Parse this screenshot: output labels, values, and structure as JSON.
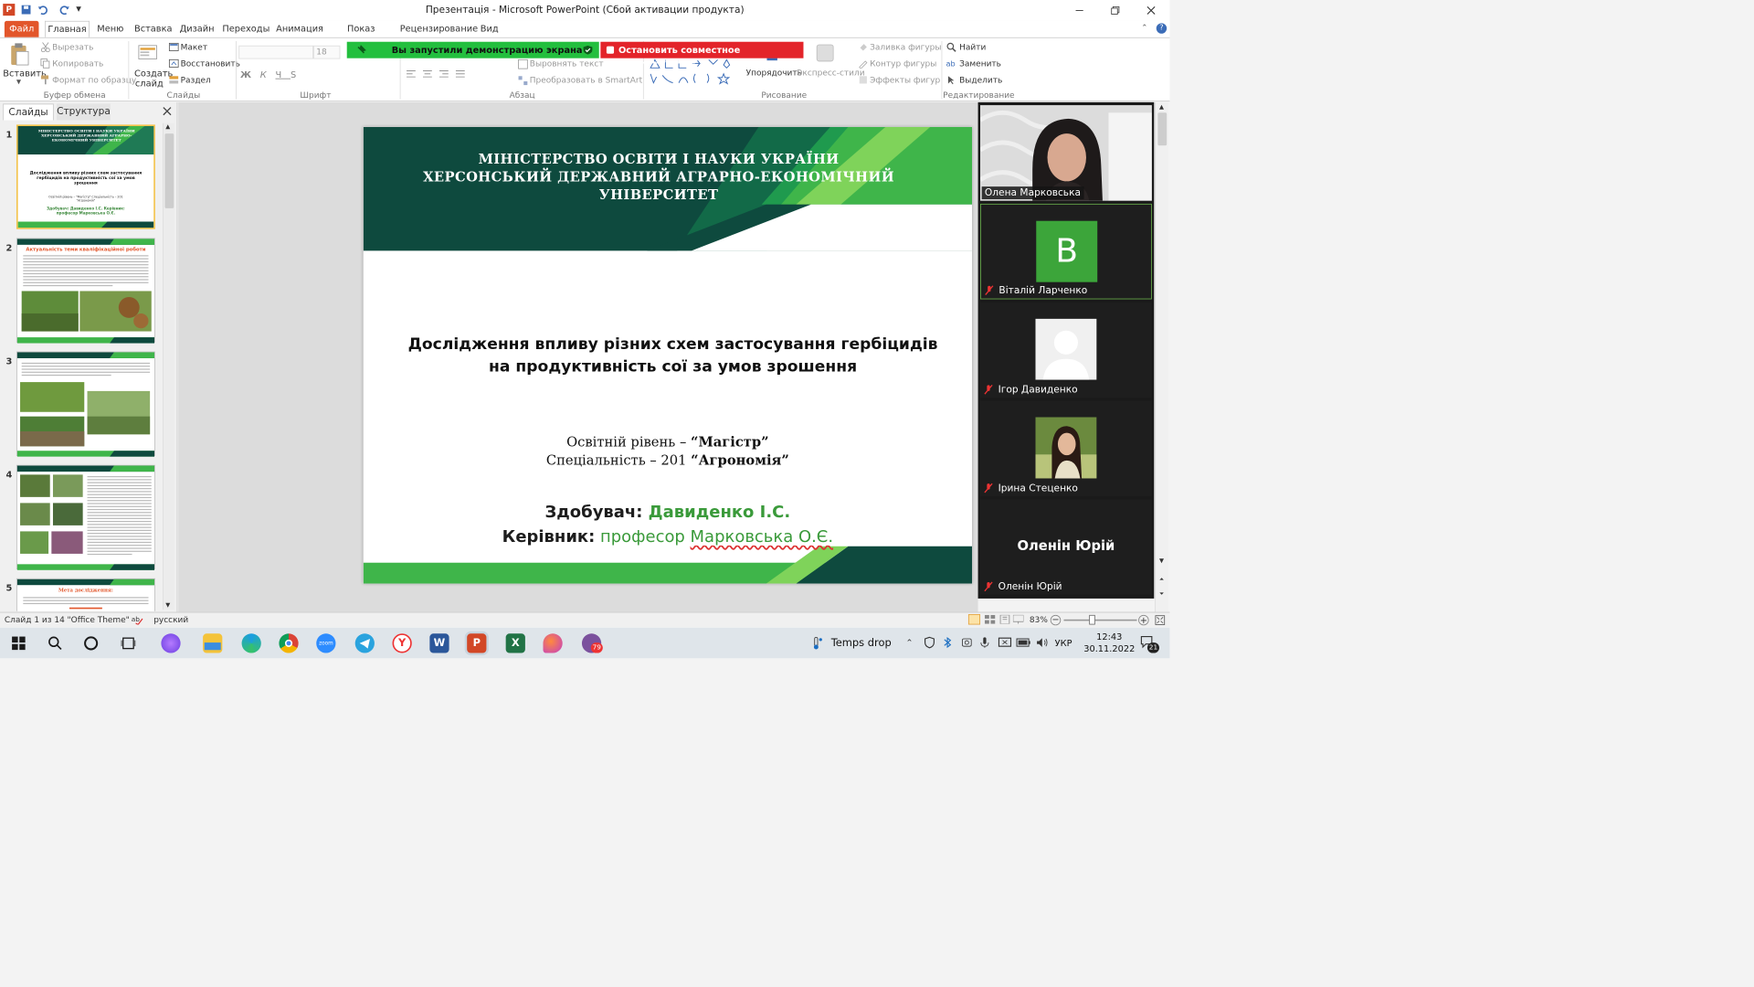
{
  "window": {
    "title": "Презентація  -  Microsoft PowerPoint (Сбой активации продукта)"
  },
  "tabs": [
    "Файл",
    "Главная",
    "Меню",
    "Вставка",
    "Дизайн",
    "Переходы",
    "Анимация",
    "Показ слайдов",
    "Рецензирование",
    "Вид"
  ],
  "ribbon": {
    "paste": "Вставить",
    "cut": "Вырезать",
    "copy": "Копировать",
    "format_painter": "Формат по образцу",
    "clipboard_group": "Буфер обмена",
    "new_slide": "Создать слайд",
    "layout": "Макет",
    "reset": "Восстановить",
    "section": "Раздел",
    "slides_group": "Слайды",
    "font_size": "18",
    "font_group": "Шрифт",
    "align_text": "Выровнять текст",
    "smartart": "Преобразовать в SmartArt",
    "paragraph_group": "Абзац",
    "arrange": "Упорядочить",
    "quick_styles": "Экспресс-стили",
    "shape_fill": "Заливка фигуры",
    "shape_outline": "Контур фигуры",
    "shape_effects": "Эффекты фигур",
    "drawing_group": "Рисование",
    "find": "Найти",
    "replace": "Заменить",
    "select": "Выделить",
    "editing_group": "Редактирование"
  },
  "share_notice": {
    "text": "Вы запустили демонстрацию экрана",
    "stop": "Остановить совместное использование"
  },
  "panel": {
    "tab_slides": "Слайды",
    "tab_outline": "Структура"
  },
  "thumbs": [
    {
      "num": "1",
      "header": "МІНІСТЕРСТВО ОСВІТИ І НАУКИ УКРАЇНИ ХЕРСОНСЬКИЙ ДЕРЖАВНИЙ АГРАРНО-ЕКОНОМІЧНИЙ УНІВЕРСИТЕТ",
      "title": "Дослідження впливу різних схем застосування гербіцидів на продуктивність сої за умов зрошення",
      "sub": "Освітній рівень – \"Магістр\" Спеціальність – 201 \"Агрономія\"",
      "authors": "Здобувач: Давиденко І.С. Керівник: професор Марковська О.Є."
    },
    {
      "num": "2",
      "title": "Актуальність теми кваліфікаційної роботи"
    },
    {
      "num": "3"
    },
    {
      "num": "4"
    },
    {
      "num": "5",
      "title": "Мета дослідження:"
    }
  ],
  "slide": {
    "header_line1": "МІНІСТЕРСТВО  ОСВІТИ  І  НАУКИ  УКРАЇНИ",
    "header_line2": "ХЕРСОНСЬКИЙ  ДЕРЖАВНИЙ  АГРАРНО-ЕКОНОМІЧНИЙ",
    "header_line3": "УНІВЕРСИТЕТ",
    "title_line1": "Дослідження впливу різних схем застосування гербіцидів",
    "title_line2": "на продуктивність сої за умов зрошення",
    "level_prefix": "Освітній рівень – ",
    "level_value": "“Магістр”",
    "spec_prefix": "Спеціальність  – 201 ",
    "spec_value": "“Агрономія”",
    "student_label": "Здобувач:",
    "student_name": " Давиденко І.С.",
    "advisor_label": "Керівник:",
    "advisor_prefix": " професор ",
    "advisor_name": "Марковська О.Є."
  },
  "participants": [
    {
      "name": "Олена Марковська"
    },
    {
      "name": "Віталій Ларченко",
      "initial": "B"
    },
    {
      "name": "Ігор Давиденко"
    },
    {
      "name": "Ірина Стеценко"
    },
    {
      "name": "Оленін Юрій",
      "big_name": "Оленін Юрій"
    }
  ],
  "status": {
    "slide_counter": "Слайд 1 из 14",
    "theme": "\"Office Theme\"",
    "language": "русский",
    "zoom": "83%"
  },
  "taskbar": {
    "weather": "Temps drop",
    "lang": "УКР",
    "time": "12:43",
    "date": "30.11.2022",
    "notif_count": "21",
    "viber_badge": "79"
  },
  "colors": {
    "accent_dark": "#0e4a3e",
    "accent_green": "#3fb54a",
    "file_tab": "#e2562b"
  }
}
